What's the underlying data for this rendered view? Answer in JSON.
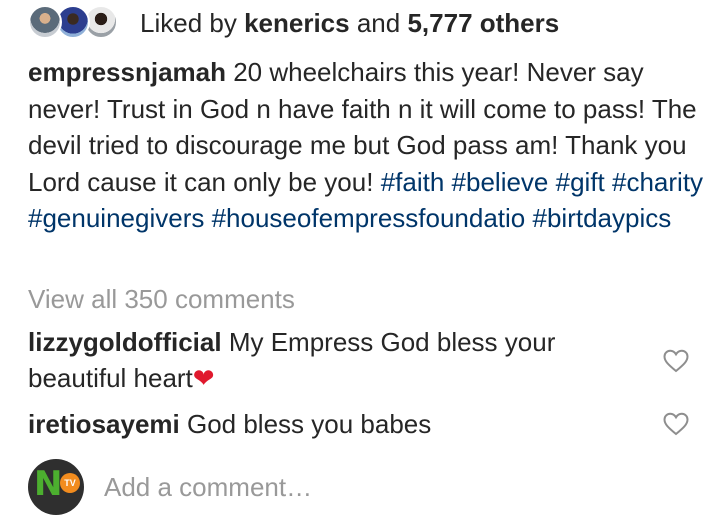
{
  "likes": {
    "prefix": "Liked by",
    "user": "kenerics",
    "conjunction": "and",
    "count": "5,777 others",
    "avatars": [
      "liker-avatar-1",
      "liker-avatar-2",
      "liker-avatar-3"
    ]
  },
  "caption": {
    "username": "empressnjamah",
    "text": "20 wheelchairs this year! Never say never! Trust in God n have faith n it will come to pass! The devil tried to discourage me but God pass am! Thank you Lord cause it can only be you!",
    "hashtags": [
      "#faith",
      "#believe",
      "#gift",
      "#charity",
      "#genuinegivers",
      "#houseofempressfoundatio",
      "#birtdaypics"
    ]
  },
  "view_all_comments": "View all 350 comments",
  "comments": [
    {
      "username": "lizzygoldofficial",
      "text": "My Empress God bless your beautiful heart",
      "emoji": "❤"
    },
    {
      "username": "iretiosayemi",
      "text": "God bless you babes",
      "emoji": ""
    }
  ],
  "add_comment": {
    "placeholder": "Add a comment…",
    "avatar_logo_letter": "N",
    "avatar_logo_badge": "TV"
  },
  "colors": {
    "text": "#262626",
    "hashtag": "#003569",
    "muted": "#999999",
    "heart_emoji": "#e0192d"
  }
}
